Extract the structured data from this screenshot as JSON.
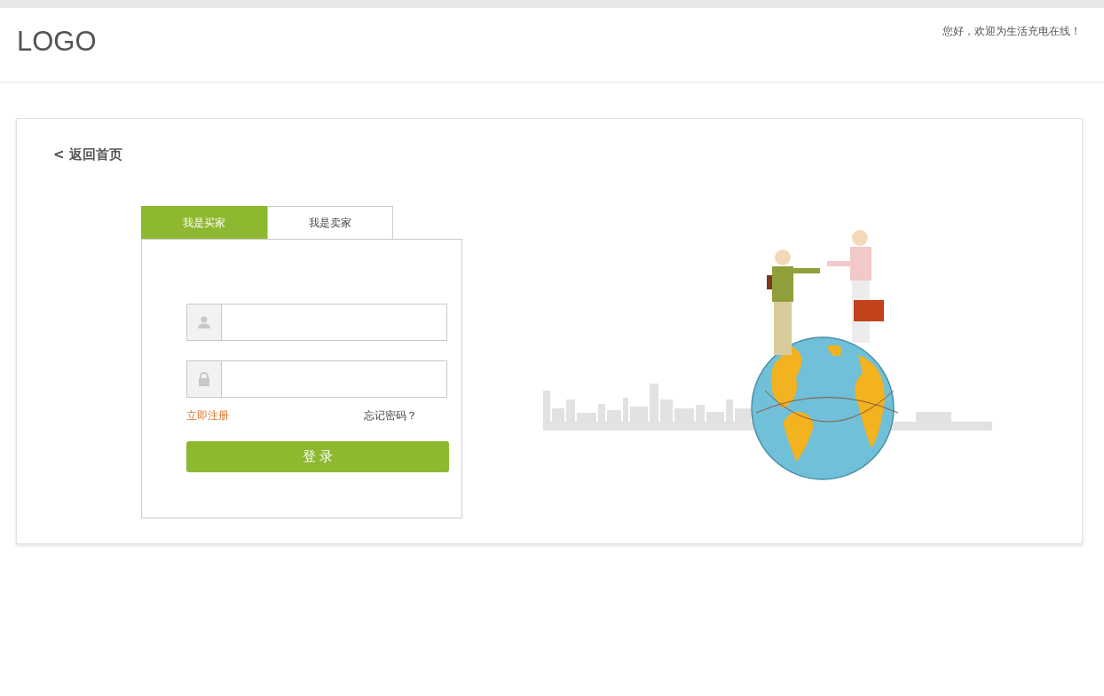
{
  "header": {
    "logo": "LOGO",
    "greeting": "您好，欢迎为生活充电在线！"
  },
  "back_link": "< 返回首页",
  "tabs": [
    {
      "label": "我是买家",
      "selected": true
    },
    {
      "label": "我是卖家",
      "selected": false
    }
  ],
  "form": {
    "links": {
      "register": "立即注册",
      "forgot": "忘记密码？"
    },
    "submit": "登 录"
  }
}
